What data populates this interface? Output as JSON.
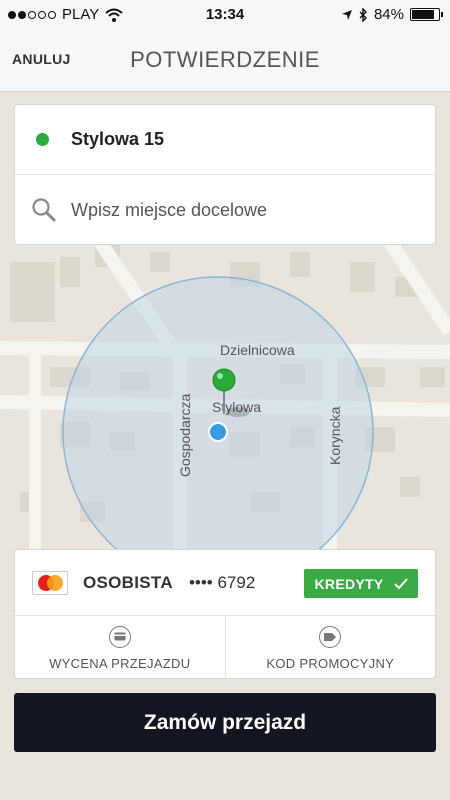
{
  "status_bar": {
    "carrier": "PLAY",
    "time": "13:34",
    "battery_percent": "84%",
    "battery_level": 0.84,
    "signal_bars_filled": 2,
    "signal_bars_total": 5
  },
  "nav": {
    "cancel_label": "ANULUJ",
    "title": "POTWIERDZENIE"
  },
  "pickup": {
    "address": "Stylowa 15"
  },
  "destination": {
    "placeholder": "Wpisz miejsce docelowe",
    "value": ""
  },
  "map": {
    "streets": {
      "dzielnicowa": "Dzielnicowa",
      "stylowa": "Stylowa",
      "gospodarcza": "Gospodarcza",
      "koryncka": "Koryncka"
    },
    "pin_color": "#2cab3d",
    "location_dot_color": "#3b9be6"
  },
  "payment": {
    "card_name": "OSOBISTA",
    "card_number": "•••• 6792",
    "card_brand_icon": "mastercard-icon",
    "credits_label": "KREDYTY",
    "credits_color": "#3aab44",
    "fare_estimate_label": "WYCENA PRZEJAZDU",
    "promo_code_label": "KOD PROMOCYJNY"
  },
  "order": {
    "button_label": "Zamów przejazd"
  }
}
